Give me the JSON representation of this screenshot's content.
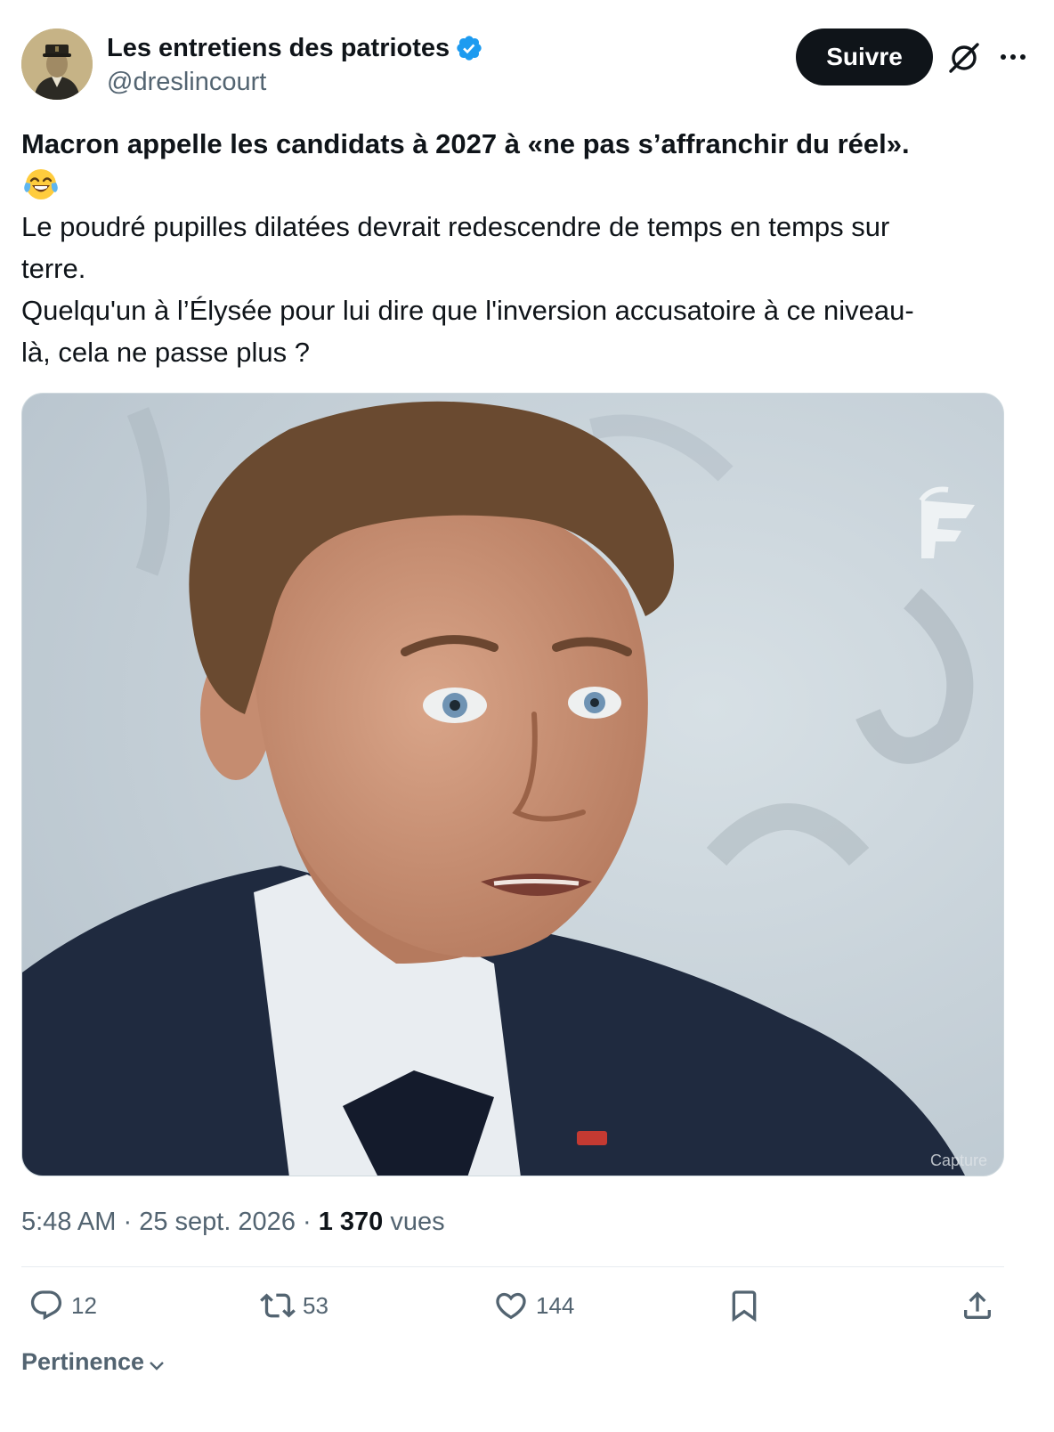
{
  "author": {
    "display_name": "Les entretiens des patriotes",
    "handle": "@dreslincourt",
    "verified": true,
    "verified_color": "#1d9bf0"
  },
  "header": {
    "follow_label": "Suivre",
    "grok_icon": "grok-icon",
    "more_icon": "more-icon"
  },
  "tweet": {
    "headline": "Macron appelle les candidats à 2027 à «ne pas s’affranchir du réel».",
    "emoji": "face-with-tears-of-joy",
    "line1": "Le poudré pupilles dilatées devrait redescendre de temps en temps sur",
    "line2": "terre.",
    "line3": "Quelqu'un à l’Élysée pour lui dire que l'inversion accusatoire à ce niveau-",
    "line4": "là, cela ne passe plus ?"
  },
  "media": {
    "watermark": "Capture"
  },
  "meta": {
    "time": "5:48 AM",
    "sep1": " · ",
    "date": "25 sept. 2026",
    "sep2": " · ",
    "views_count": "1 370",
    "views_label": " vues"
  },
  "actions": {
    "replies": "12",
    "reposts": "53",
    "likes": "144"
  },
  "sort": {
    "label": "Pertinence"
  }
}
